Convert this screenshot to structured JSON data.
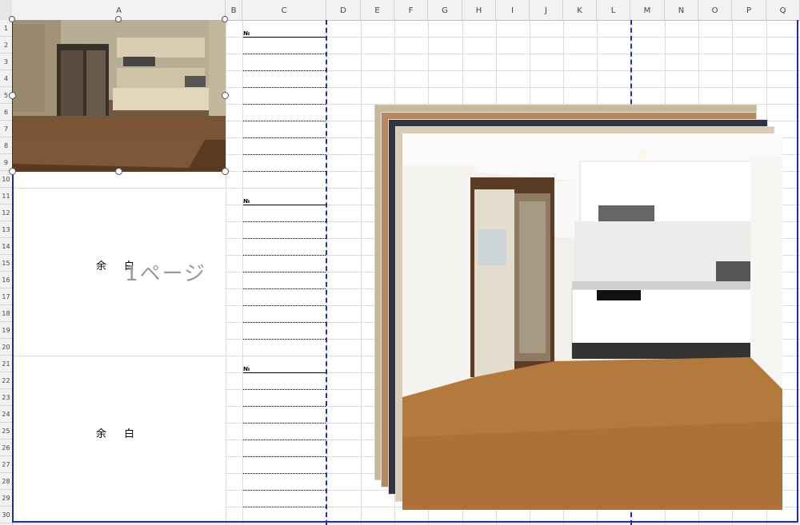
{
  "columns": [
    "A",
    "B",
    "C",
    "D",
    "E",
    "F",
    "G",
    "H",
    "I",
    "J",
    "K",
    "L",
    "M",
    "N",
    "O",
    "P",
    "Q"
  ],
  "rows": [
    "1",
    "2",
    "3",
    "4",
    "5",
    "6",
    "7",
    "8",
    "9",
    "10",
    "11",
    "12",
    "13",
    "14",
    "15",
    "16",
    "17",
    "18",
    "19",
    "20",
    "21",
    "22",
    "23",
    "24",
    "25",
    "26",
    "27",
    "28",
    "29",
    "30"
  ],
  "cells": {
    "no_label_1": "№",
    "no_label_2": "№",
    "no_label_3": "№",
    "blank_label_1": "余白",
    "blank_label_2": "余白"
  },
  "watermark": "1ページ",
  "colors": {
    "page_break": "#1f2fa8",
    "grid": "#dcdcdc",
    "header_bg": "#f2f2f2"
  },
  "images": {
    "before_photo": "old-kitchen-photo",
    "after_photo": "renovated-kitchen-photo",
    "stack_count": 5
  }
}
